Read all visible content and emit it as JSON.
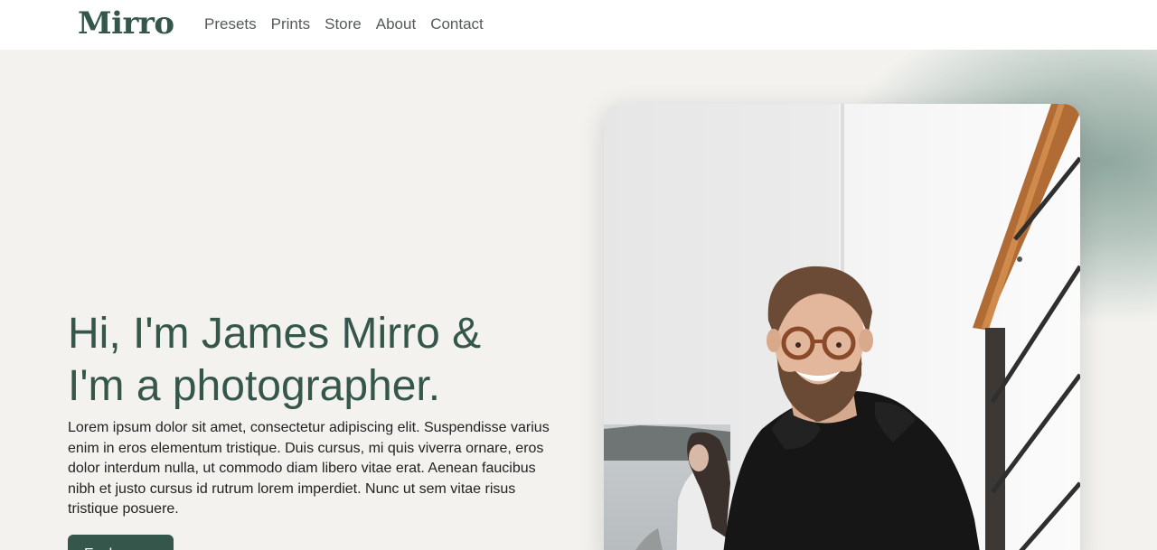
{
  "brand": {
    "logo_text": "Mirro"
  },
  "nav": {
    "links": [
      {
        "label": "Presets"
      },
      {
        "label": "Prints"
      },
      {
        "label": "Store"
      },
      {
        "label": "About"
      },
      {
        "label": "Contact"
      }
    ]
  },
  "hero": {
    "headline_line1": "Hi, I'm James Mirro &",
    "headline_line2": "I'm a photographer.",
    "intro": "Lorem ipsum dolor sit amet, consectetur adipiscing elit. Suspendisse varius enim in eros elementum tristique. Duis cursus, mi quis viverra ornare, eros dolor interdum nulla, ut commodo diam libero vitae erat. Aenean faucibus nibh et justo cursus id rutrum lorem imperdiet. Nunc ut sem vitae risus tristique posuere.",
    "cta_label": "Explore"
  },
  "colors": {
    "brand_green": "#35564b",
    "page_background": "#f3f2ef",
    "nav_text": "#555a58"
  }
}
